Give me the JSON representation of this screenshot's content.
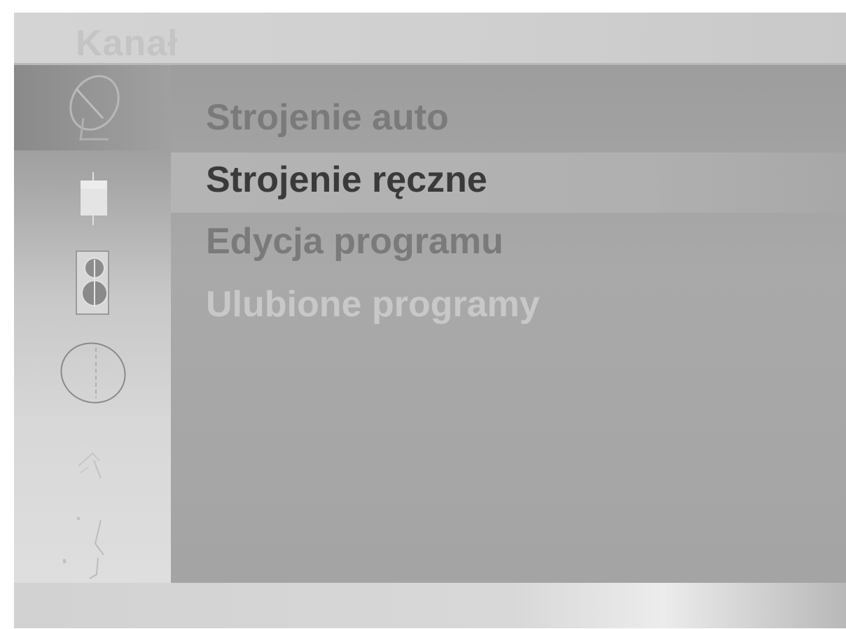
{
  "window": {
    "title": "Kanał"
  },
  "sidebar": {
    "items": [
      {
        "icon": "satellite-dish-icon",
        "active": true
      },
      {
        "icon": "picture-icon",
        "active": false
      },
      {
        "icon": "speaker-icon",
        "active": false
      },
      {
        "icon": "clock-icon",
        "active": false
      },
      {
        "icon": "settings-icon",
        "active": false
      },
      {
        "icon": "input-icon",
        "active": false
      }
    ]
  },
  "menu": {
    "items": [
      {
        "label": "Strojenie auto",
        "state": "normal"
      },
      {
        "label": "Strojenie ręczne",
        "state": "selected"
      },
      {
        "label": "Edycja programu",
        "state": "normal"
      },
      {
        "label": "Ulubione programy",
        "state": "disabled"
      }
    ]
  },
  "colors": {
    "selected_text": "#3a3a3a",
    "normal_text": "#7a7a7a",
    "disabled_text": "#c8c8c8",
    "title_text": "#c4c4c4",
    "panel_bg": "#a6a6a6"
  }
}
